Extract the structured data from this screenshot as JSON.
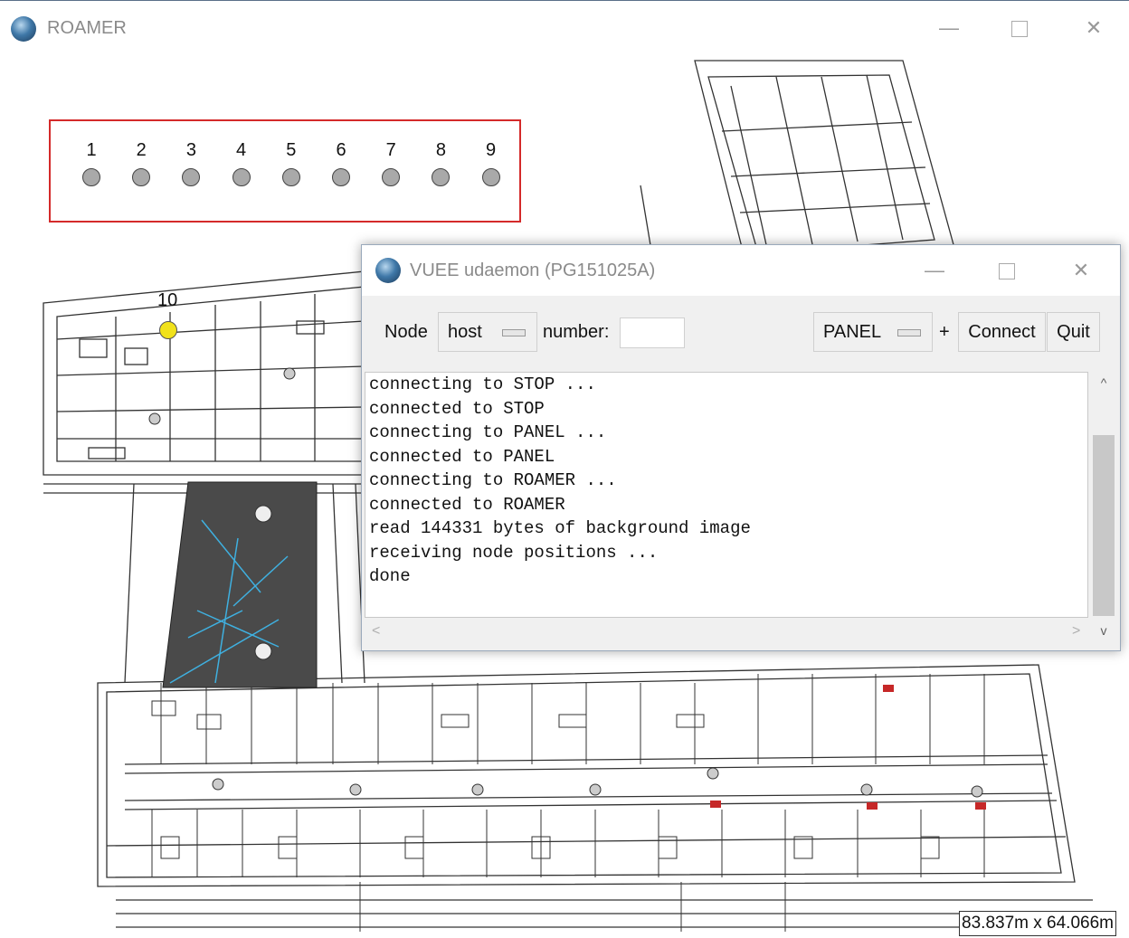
{
  "main_window": {
    "title": "ROAMER",
    "minimize_glyph": "—",
    "close_glyph": "✕"
  },
  "map": {
    "panel_nodes": [
      "1",
      "2",
      "3",
      "4",
      "5",
      "6",
      "7",
      "8",
      "9"
    ],
    "node10_label": "10",
    "scale_readout": "83.837m x 64.066m",
    "colors": {
      "panel_border": "#d42a2a",
      "inactive_led": "#a9a9a9",
      "active_led": "#f1e21b",
      "plan_lines": "#333333",
      "lightwell": "#4a4a4a",
      "lightwell_lines": "#3fb0e0"
    }
  },
  "dialog": {
    "title": "VUEE udaemon (PG151025A)",
    "minimize_glyph": "—",
    "close_glyph": "✕",
    "node_label": "Node",
    "node_select_value": "host",
    "number_label": "number:",
    "number_value": "",
    "target_select_value": "PANEL",
    "plus_label": "+",
    "connect_button": "Connect",
    "quit_button": "Quit",
    "log_lines": [
      "connecting to STOP ...",
      "connected to STOP",
      "connecting to PANEL ...",
      "connected to PANEL",
      "connecting to ROAMER ...",
      "connected to ROAMER",
      "read 144331 bytes of background image",
      "receiving node positions ...",
      "done"
    ],
    "scroll_up_glyph": "^",
    "scroll_down_glyph": "v",
    "scroll_left_glyph": "<",
    "scroll_right_glyph": ">"
  }
}
